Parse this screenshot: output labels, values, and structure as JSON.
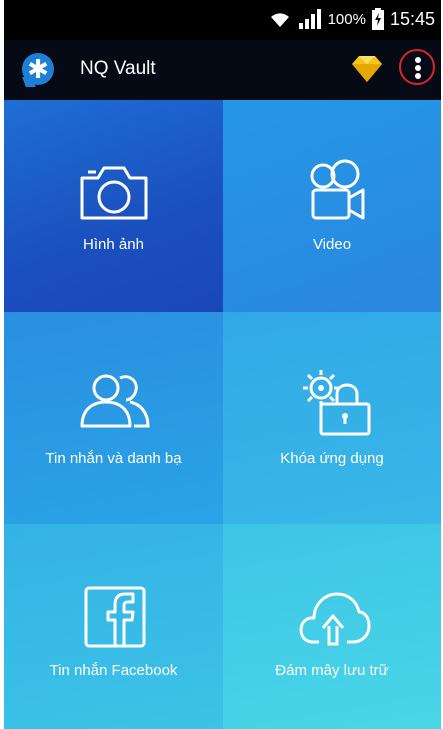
{
  "status_bar": {
    "battery_percent": "100%",
    "time": "15:45",
    "icons": [
      "wifi-icon",
      "signal-icon",
      "battery-icon"
    ]
  },
  "app_bar": {
    "title": "NQ Vault",
    "logo_icon": "vault-asterisk-icon",
    "premium_icon": "diamond-icon",
    "menu_icon": "more-vert-icon"
  },
  "tiles": [
    {
      "label": "Hình ảnh",
      "icon": "camera-icon"
    },
    {
      "label": "Video",
      "icon": "video-camera-icon"
    },
    {
      "label": "Tin nhắn và danh bạ",
      "icon": "contacts-icon"
    },
    {
      "label": "Khóa ứng dụng",
      "icon": "app-lock-icon"
    },
    {
      "label": "Tin nhắn Facebook",
      "icon": "facebook-icon"
    },
    {
      "label": "Đám mây lưu trữ",
      "icon": "cloud-upload-icon"
    }
  ],
  "colors": {
    "accent_blue": "#1e6fd3",
    "highlight_red": "#d9262c",
    "diamond_yellow": "#f5c518"
  }
}
